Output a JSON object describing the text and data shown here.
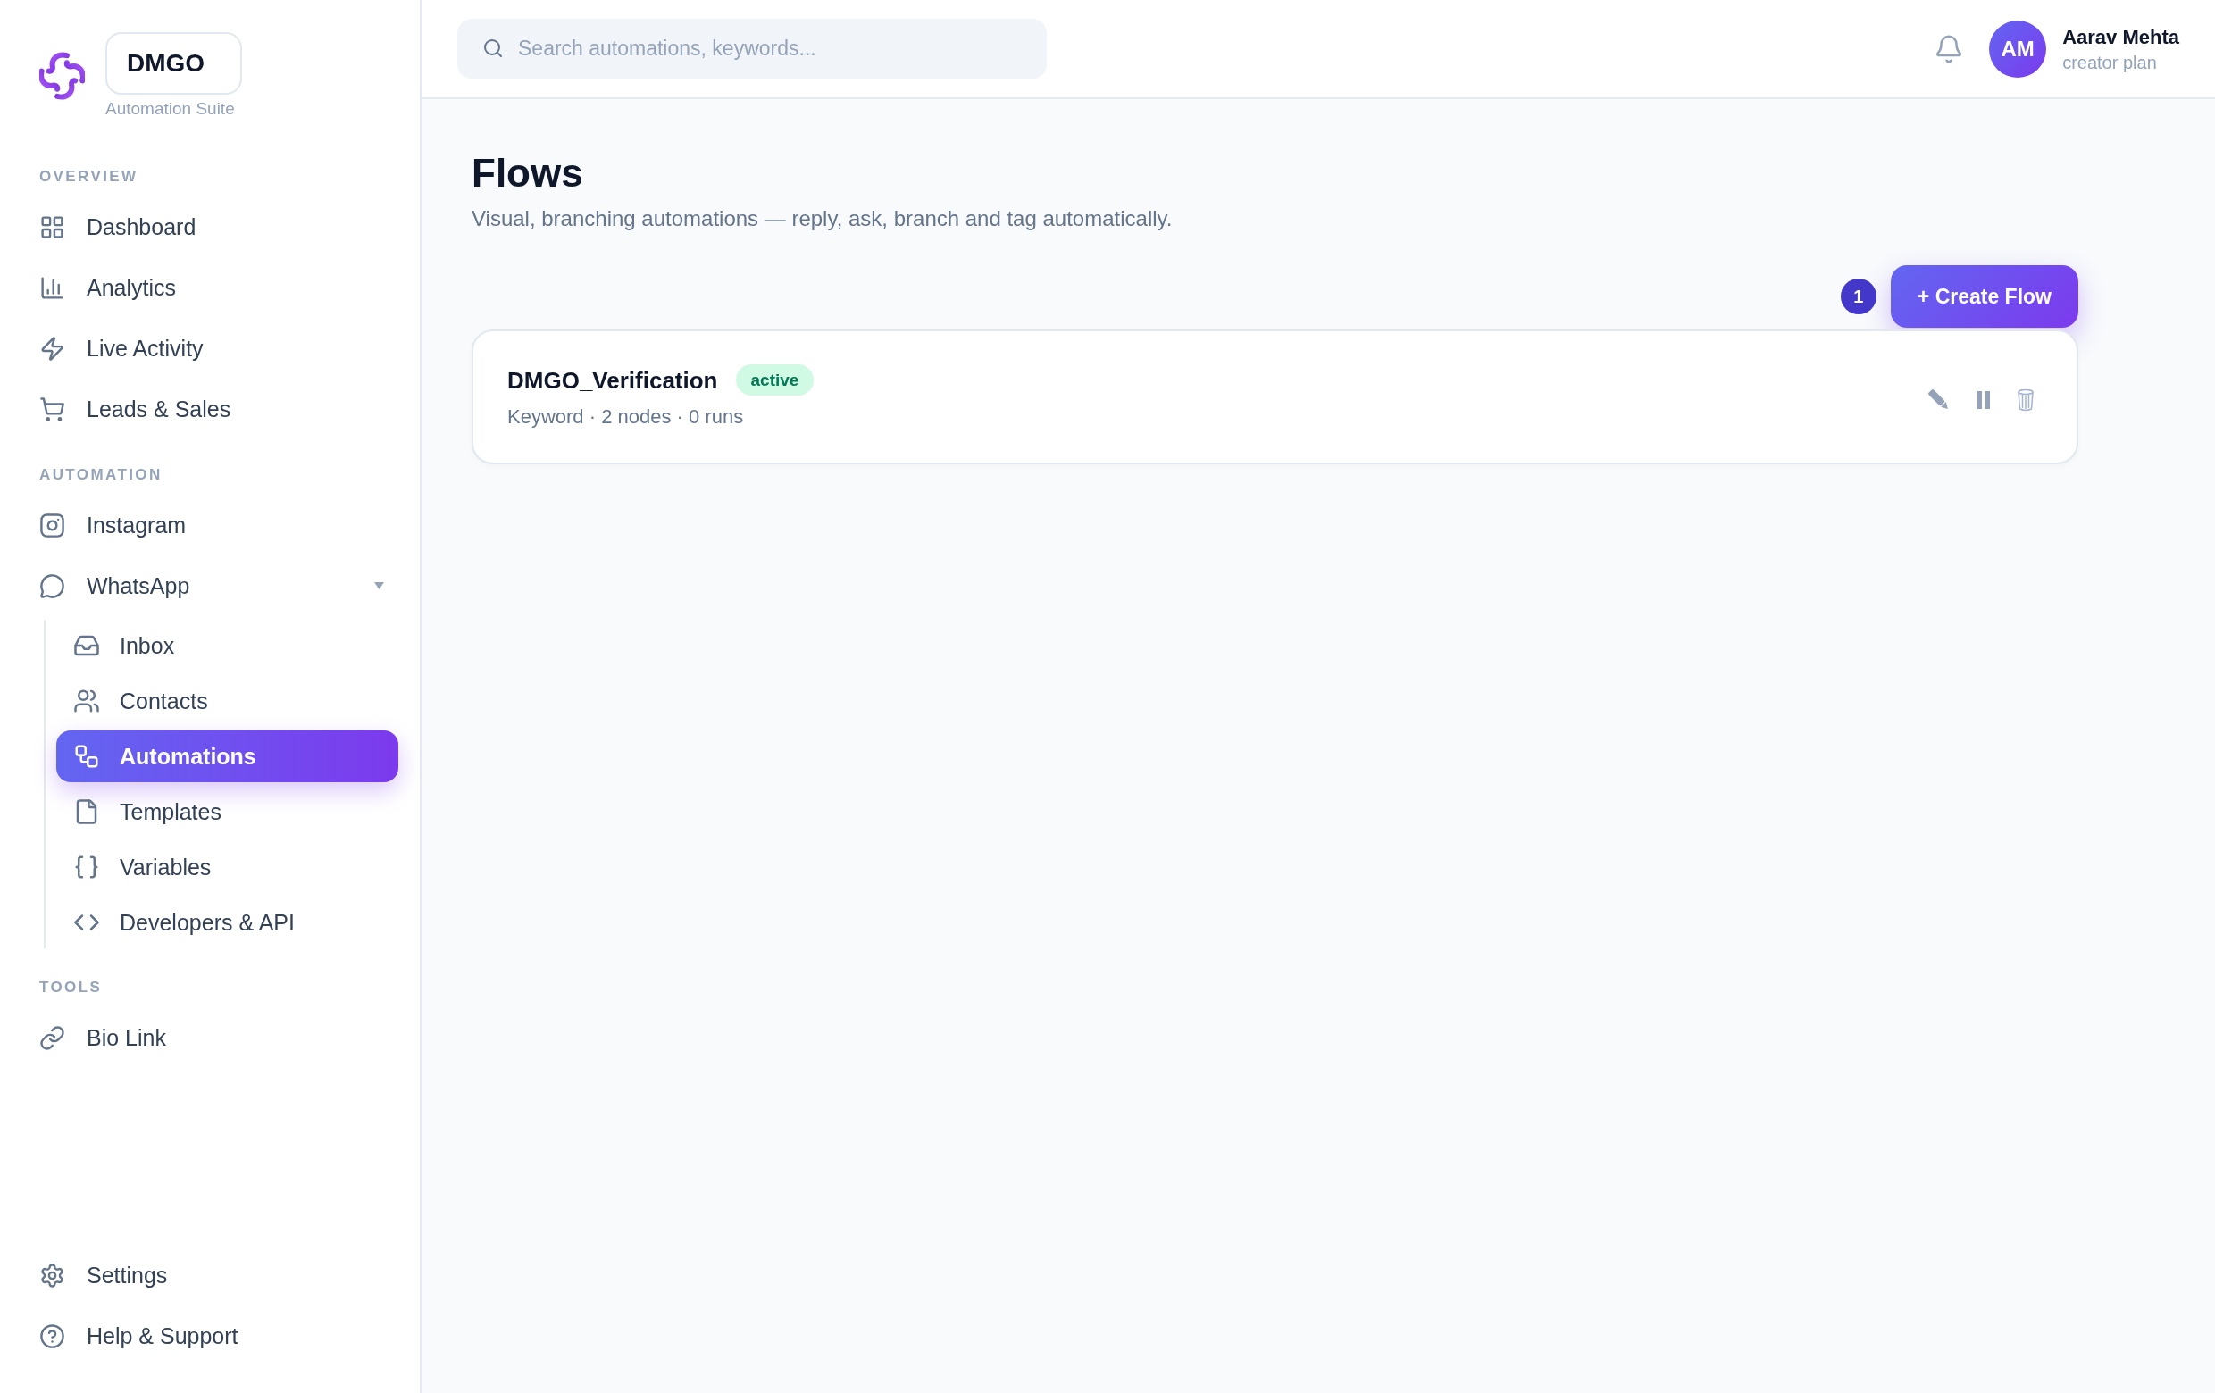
{
  "brand": {
    "name": "DMGO",
    "tagline": "Automation Suite"
  },
  "sidebar": {
    "sections": [
      {
        "label": "OVERVIEW",
        "items": [
          {
            "label": "Dashboard",
            "selected": false
          },
          {
            "label": "Analytics",
            "selected": false
          },
          {
            "label": "Live Activity",
            "selected": false
          },
          {
            "label": "Leads & Sales",
            "selected": false
          }
        ]
      },
      {
        "label": "AUTOMATION",
        "items": [
          {
            "label": "Instagram",
            "selected": false
          },
          {
            "label": "WhatsApp",
            "selected": false,
            "expanded": true,
            "children": [
              {
                "label": "Inbox",
                "selected": false
              },
              {
                "label": "Contacts",
                "selected": false
              },
              {
                "label": "Automations",
                "selected": true
              },
              {
                "label": "Templates",
                "selected": false
              },
              {
                "label": "Variables",
                "selected": false
              },
              {
                "label": "Developers & API",
                "selected": false
              }
            ]
          }
        ]
      },
      {
        "label": "TOOLS",
        "items": [
          {
            "label": "Bio Link",
            "selected": false
          }
        ]
      }
    ],
    "footer": [
      {
        "label": "Settings",
        "selected": false
      },
      {
        "label": "Help & Support",
        "selected": false
      }
    ]
  },
  "header": {
    "search": {
      "placeholder": "Search automations, keywords..."
    },
    "user": {
      "initials": "AM",
      "name": "Aarav Mehta",
      "plan": "creator plan"
    }
  },
  "page": {
    "title": "Flows",
    "subtitle": "Visual, branching automations — reply, ask, branch and tag automatically.",
    "flow_count": "1",
    "create_button": "+ Create Flow"
  },
  "flows": [
    {
      "name": "DMGO_Verification",
      "status": "active",
      "meta": "Keyword · 2 nodes · 0 runs"
    }
  ]
}
